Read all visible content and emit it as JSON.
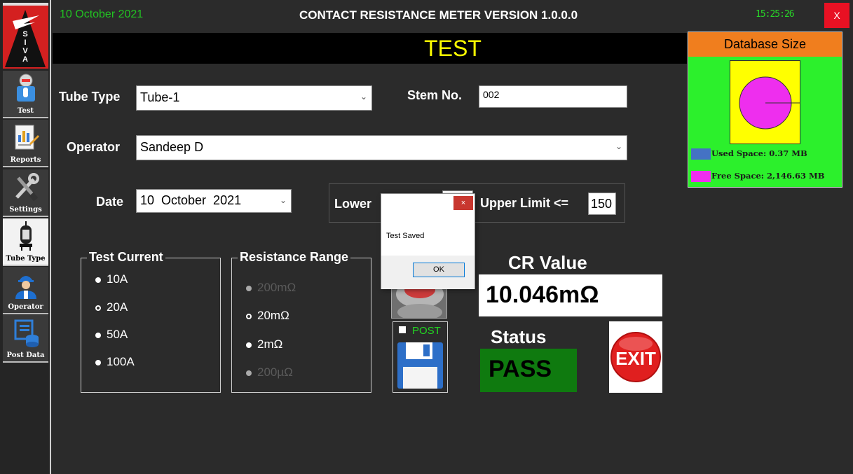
{
  "logo": {
    "letters": [
      "S",
      "I",
      "V",
      "A"
    ]
  },
  "sidebar": {
    "items": [
      {
        "label": "Test",
        "icon": "test-hand-icon"
      },
      {
        "label": "Reports",
        "icon": "reports-icon"
      },
      {
        "label": "Settings",
        "icon": "settings-tools-icon"
      },
      {
        "label": "Tube Type",
        "icon": "vacuum-tube-icon"
      },
      {
        "label": "Operator",
        "icon": "operator-icon"
      },
      {
        "label": "Post Data",
        "icon": "post-data-icon"
      }
    ]
  },
  "topbar": {
    "date": "10 October 2021",
    "title": "CONTACT RESISTANCE METER VERSION 1.0.0.0",
    "clock": "15:25:26",
    "close_label": "X"
  },
  "page": {
    "title": "TEST"
  },
  "form": {
    "tube_type_label": "Tube Type",
    "tube_type_value": "Tube-1",
    "stem_label": "Stem No.",
    "stem_value": "002",
    "operator_label": "Operator",
    "operator_value": "Sandeep D",
    "date_label": "Date",
    "date_value": "10  October  2021",
    "lower_limit_label": "Lower",
    "upper_limit_label": "Upper Limit <=",
    "upper_limit_value": "150"
  },
  "test_current": {
    "title": "Test Current",
    "options": [
      "10A",
      "20A",
      "50A",
      "100A"
    ],
    "selected": "20A"
  },
  "resistance_range": {
    "title": "Resistance Range",
    "options": [
      "200mΩ",
      "20mΩ",
      "2mΩ",
      "200µΩ"
    ],
    "selected": "20mΩ"
  },
  "result": {
    "cr_label": "CR Value",
    "cr_value": "10.046mΩ",
    "status_label": "Status",
    "status_value": "PASS",
    "status_color": "#0f7a0f"
  },
  "post": {
    "label": "POST"
  },
  "exit": {
    "label": "EXIT"
  },
  "database": {
    "title": "Database Size",
    "used_label": "Used Space: 0.37 MB",
    "free_label": "Free Space: 2,146.63 MB",
    "used_mb": 0.37,
    "free_mb": 2146.63,
    "used_color": "#4472c4",
    "free_color": "#ee2eee"
  },
  "dialog": {
    "message": "Test Saved",
    "ok_label": "OK",
    "close_label": "×"
  }
}
